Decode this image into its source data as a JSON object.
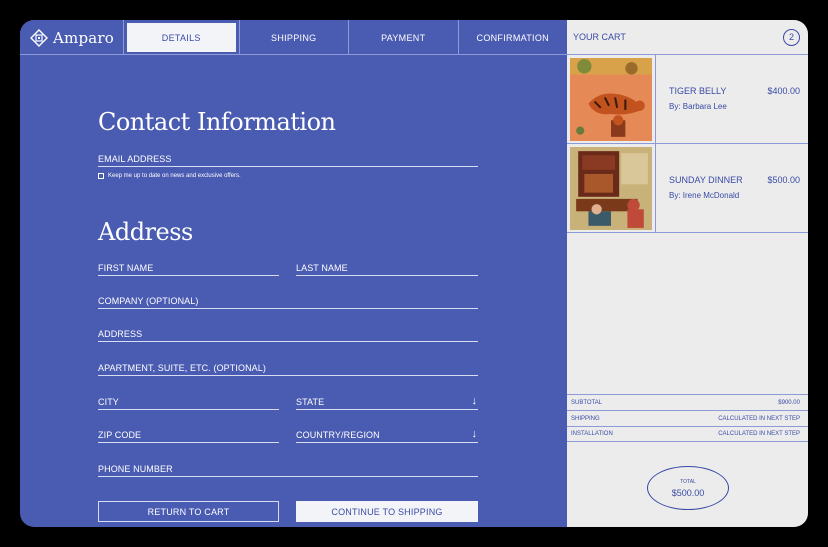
{
  "brand": {
    "name": "Amparo"
  },
  "tabs": [
    {
      "label": "DETAILS",
      "active": true
    },
    {
      "label": "SHIPPING",
      "active": false
    },
    {
      "label": "PAYMENT",
      "active": false
    },
    {
      "label": "CONFIRMATION",
      "active": false
    }
  ],
  "contact": {
    "heading": "Contact Information",
    "email_label": "EMAIL ADDRESS",
    "newsletter_label": "Keep me up to date on news and exclusive offers."
  },
  "address": {
    "heading": "Address",
    "first_name": "FIRST NAME",
    "last_name": "LAST NAME",
    "company": "COMPANY (OPTIONAL)",
    "address": "ADDRESS",
    "apartment": "APARTMENT, SUITE, ETC. (OPTIONAL)",
    "city": "CITY",
    "state": "STATE",
    "zip": "ZIP CODE",
    "country": "COUNTRY/REGION",
    "phone": "PHONE NUMBER"
  },
  "actions": {
    "return_label": "RETURN TO CART",
    "continue_label": "CONTINUE TO SHIPPING"
  },
  "cart": {
    "title": "YOUR CART",
    "count": "2",
    "items": [
      {
        "name": "TIGER BELLY",
        "artist": "By: Barbara Lee",
        "price": "$400.00"
      },
      {
        "name": "SUNDAY DINNER",
        "artist": "By: Irene McDonald",
        "price": "$500.00"
      }
    ],
    "summary": {
      "subtotal_label": "SUBTOTAL",
      "subtotal_value": "$900.00",
      "shipping_label": "SHIPPING",
      "shipping_value": "CALCULATED IN NEXT STEP",
      "installation_label": "INSTALLATION",
      "installation_value": "CALCULATED IN NEXT STEP"
    },
    "total_label": "TOTAL",
    "total_value": "$500.00"
  },
  "colors": {
    "primary": "#4a5bb2",
    "panel": "#ececec",
    "accent_text": "#3a4aa5"
  },
  "icons": {
    "logo": "amparo-logo-icon",
    "select_arrow": "arrow-down-icon"
  }
}
